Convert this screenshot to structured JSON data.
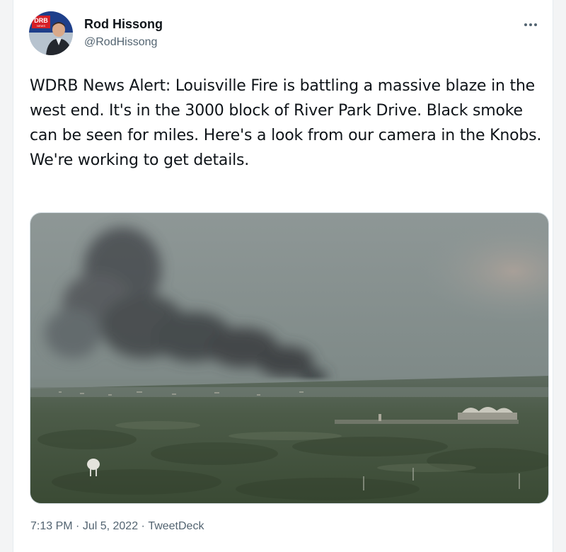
{
  "tweet": {
    "avatar_logo_text": "DRB",
    "avatar_logo_subtext": "NEWS",
    "display_name": "Rod Hissong",
    "handle": "@RodHissong",
    "text": "WDRB News Alert: Louisville Fire is battling a massive blaze in the west end. It's in the 3000 block of River Park Drive. Black smoke can be seen for miles. Here's a look from our camera in the Knobs. We're working to get details.",
    "media_icon": "photo-smoke-plume-over-city",
    "time": "7:13 PM",
    "separator": " · ",
    "date": "Jul 5, 2022",
    "source": "TweetDeck"
  },
  "icons": {
    "more": "more-horizontal-icon"
  },
  "colors": {
    "text": "#0f1419",
    "secondary": "#536471",
    "border": "#cfd9de"
  }
}
